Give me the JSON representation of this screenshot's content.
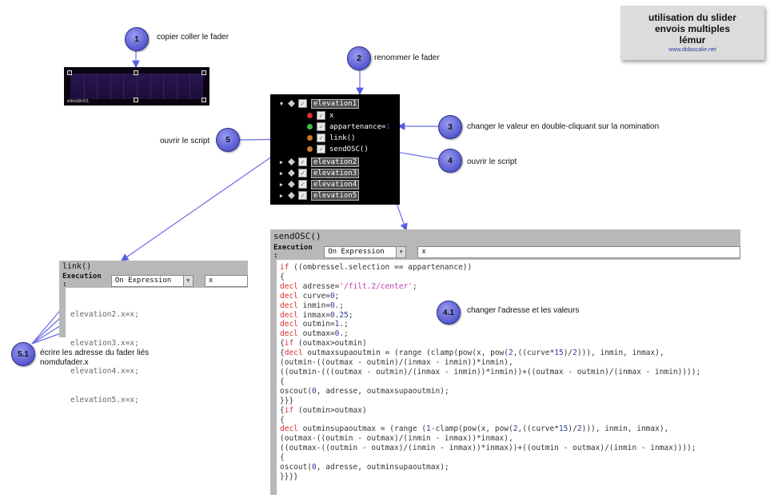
{
  "title_card": {
    "line1": "utilisation du slider",
    "line2": "envois multiples",
    "line3": "lémur",
    "url": "www.didascalie.net"
  },
  "steps": {
    "s1": "1",
    "s2": "2",
    "s3": "3",
    "s4": "4",
    "s5": "5",
    "s41": "4.1",
    "s51": "5.1"
  },
  "notes": {
    "n1": "copier coller le fader",
    "n2": "renommer le fader",
    "n3": "changer le valeur en double-cliquant sur la nomination",
    "n4": "ouvrir le script",
    "n5": "ouvrir le script",
    "n41": "changer l'adresse et les valeurs",
    "n51a": "écrire les adresse du fader liés",
    "n51b": "nomdufader.x"
  },
  "fader": {
    "label": "elevation1"
  },
  "tree": {
    "rows": [
      {
        "label": "elevation1",
        "selected": true
      },
      {
        "label": "x"
      },
      {
        "label": "appartenance=",
        "value": "1"
      },
      {
        "label": "link()"
      },
      {
        "label": "sendOSC()"
      },
      {
        "label": "elevation2"
      },
      {
        "label": "elevation3"
      },
      {
        "label": "elevation4"
      },
      {
        "label": "elevation5"
      }
    ],
    "colors": {
      "red": "#d9302c",
      "green": "#3fbf3f",
      "orange": "#c97a2a"
    }
  },
  "link_panel": {
    "title": "link()",
    "execution_label": "Execution :",
    "execution_value": "On Expression",
    "variable": "x",
    "lines": [
      "elevation2.x=x;",
      "elevation3.x=x;",
      "elevation4.x=x;",
      "elevation5.x=x;"
    ]
  },
  "send_panel": {
    "title": "sendOSC()",
    "execution_label": "Execution :",
    "execution_value": "On Expression",
    "variable": "x",
    "lines": [
      "if ((ombressel.selection == appartenance))",
      "{",
      "decl adresse='/filt.2/center';",
      "decl curve=0;",
      "decl inmin=0.;",
      "decl inmax=0.25;",
      "decl outmin=1.;",
      "decl outmax=0.;",
      "{if (outmax>outmin)",
      "{decl outmaxsupaoutmin = (range (clamp(pow(x, pow(2,((curve*15)/2))), inmin, inmax),",
      "(outmin-((outmax - outmin)/(inmax - inmin))*inmin),",
      "((outmin-(((outmax - outmin)/(inmax - inmin))*inmin))+((outmax - outmin)/(inmax - inmin))));",
      "{",
      "oscout(0, adresse, outmaxsupaoutmin);",
      "}}}",
      "{if (outmin>outmax)",
      "{",
      "decl outminsupaoutmax = (range (1-clamp(pow(x, pow(2,((curve*15)/2))), inmin, inmax),",
      "(outmax-((outmin - outmax)/(inmin - inmax))*inmax),",
      "((outmax-((outmin - outmax)/(inmin - inmax))*inmax))+((outmin - outmax)/(inmin - inmax))));",
      "{",
      "oscout(0, adresse, outminsupaoutmax);",
      "}}}}"
    ]
  }
}
